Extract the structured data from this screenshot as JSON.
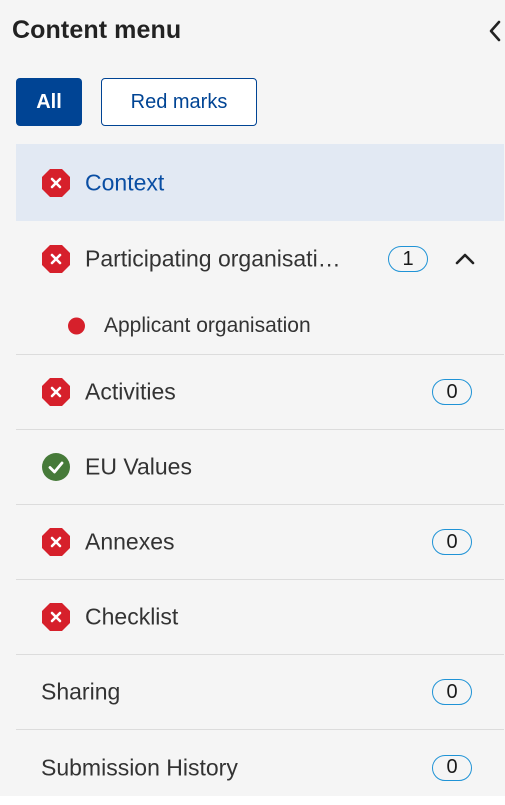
{
  "header": {
    "title": "Content menu",
    "collapse_icon": "chevron-left-icon"
  },
  "filters": {
    "all_label": "All",
    "red_marks_label": "Red marks",
    "active": "All"
  },
  "menu": {
    "items": [
      {
        "label": "Context",
        "status": "error",
        "active": true
      },
      {
        "label": "Participating organisati…",
        "status": "error",
        "count": "1",
        "expanded": true,
        "children": [
          {
            "label": "Applicant organisation",
            "status": "error"
          }
        ]
      },
      {
        "label": "Activities",
        "status": "error",
        "count": "0"
      },
      {
        "label": "EU Values",
        "status": "ok"
      },
      {
        "label": "Annexes",
        "status": "error",
        "count": "0"
      },
      {
        "label": "Checklist",
        "status": "error"
      },
      {
        "label": "Sharing",
        "count": "0"
      },
      {
        "label": "Submission History",
        "count": "0"
      }
    ]
  },
  "colors": {
    "primary": "#004494",
    "active_background": "#e2e9f3",
    "error_red": "#d6202b",
    "success_green": "#467a39",
    "count_border": "#1f93d6",
    "panel_background": "#f5f5f5"
  },
  "icons": {
    "error": "error-octagon-icon",
    "ok": "check-circle-icon",
    "expand": "chevron-up-icon",
    "child_status": "red-dot-icon"
  }
}
